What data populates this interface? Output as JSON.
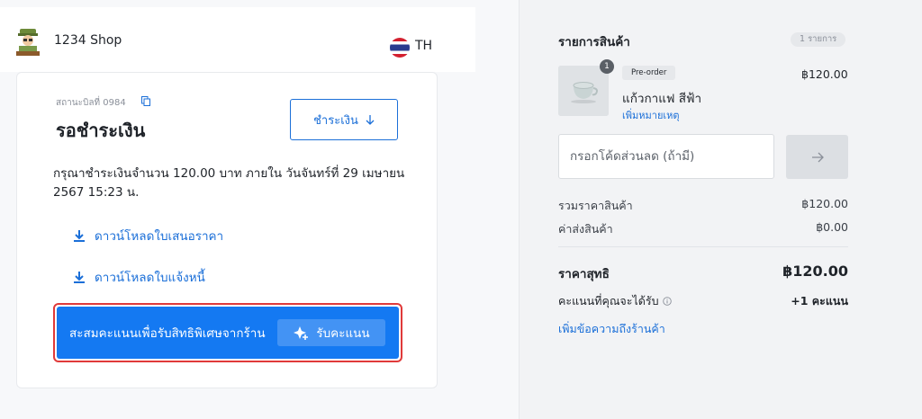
{
  "header": {
    "shop_name": "1234 Shop",
    "language": "TH"
  },
  "bill": {
    "number_label": "สถานะบิลที่ 0984",
    "status_title": "รอชำระเงิน",
    "pay_button_label": "ชำระเงิน",
    "payment_instruction": "กรุณาชำระเงินจำนวน 120.00 บาท ภายใน วันจันทร์ที่ 29 เมษายน 2567 15:23 น.",
    "download_quotation": "ดาวน์โหลดใบเสนอราคา",
    "download_invoice": "ดาวน์โหลดใบแจ้งหนี้"
  },
  "reward": {
    "text": "สะสมคะแนนเพื่อรับสิทธิพิเศษจากร้าน",
    "button_label": "รับคะแนน"
  },
  "cart": {
    "title": "รายการสินค้า",
    "count_badge": "1 รายการ",
    "items": [
      {
        "quantity": "1",
        "tag": "Pre-order",
        "name": "แก้วกาแฟ สีฟ้า",
        "note_link": "เพิ่มหมายเหตุ",
        "price": "฿120.00"
      }
    ],
    "coupon_placeholder": "กรอกโค้ดส่วนลด (ถ้ามี)",
    "subtotal_label": "รวมราคาสินค้า",
    "subtotal_value": "฿120.00",
    "shipping_label": "ค่าส่งสินค้า",
    "shipping_value": "฿0.00",
    "total_label": "ราคาสุทธิ",
    "total_value": "฿120.00",
    "points_label": "คะแนนที่คุณจะได้รับ",
    "points_value": "+1 คะแนน",
    "add_message_link": "เพิ่มข้อความถึงร้านค้า"
  },
  "colors": {
    "accent": "#1479f2",
    "link": "#1b6fd8",
    "highlight_outline": "#e03a3a"
  }
}
